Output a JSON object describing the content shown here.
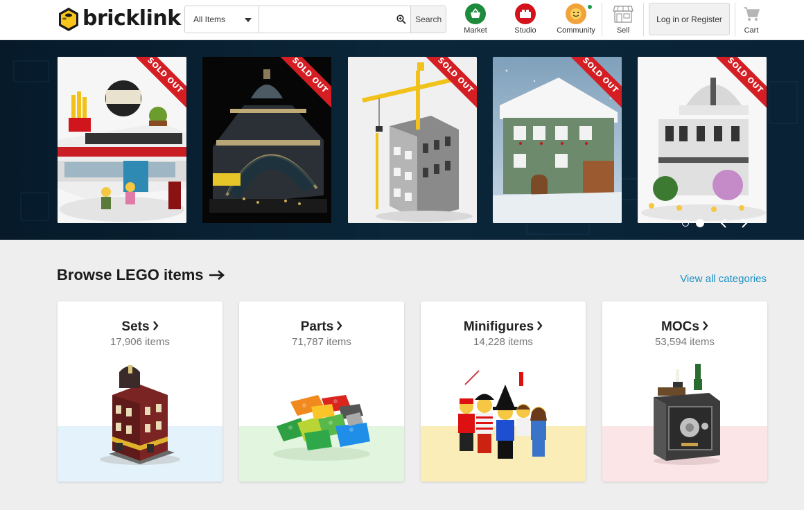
{
  "header": {
    "logo_text": "bricklink",
    "search": {
      "category": "All Items",
      "placeholder": "",
      "button_label": "Search"
    },
    "nav": {
      "market": "Market",
      "studio": "Studio",
      "community": "Community",
      "sell": "Sell",
      "cart": "Cart"
    },
    "login_label": "Log in or Register"
  },
  "hero": {
    "slides": [
      {
        "badge": "SOLD OUT",
        "subject": "diner"
      },
      {
        "badge": "SOLD OUT",
        "subject": "train-station"
      },
      {
        "badge": "SOLD OUT",
        "subject": "construction-crane"
      },
      {
        "badge": "SOLD OUT",
        "subject": "winter-chalet"
      },
      {
        "badge": "SOLD OUT",
        "subject": "observatory"
      }
    ],
    "pages": 2,
    "active_page": 2
  },
  "browse": {
    "title": "Browse LEGO items",
    "view_all": "View all categories",
    "categories": [
      {
        "name": "Sets",
        "count": "17,906 items",
        "band_color": "#e3f2fb"
      },
      {
        "name": "Parts",
        "count": "71,787 items",
        "band_color": "#e2f6df"
      },
      {
        "name": "Minifigures",
        "count": "14,228 items",
        "band_color": "#fbedb8"
      },
      {
        "name": "MOCs",
        "count": "53,594 items",
        "band_color": "#fbe5e7"
      }
    ]
  },
  "colors": {
    "accent_link": "#1a8fc2",
    "market_icon": "#1e8a3c",
    "studio_icon": "#d3121c",
    "community_icon": "#f2a23a",
    "sold_out": "#d41e23",
    "hero_bg": "#0b2639"
  }
}
